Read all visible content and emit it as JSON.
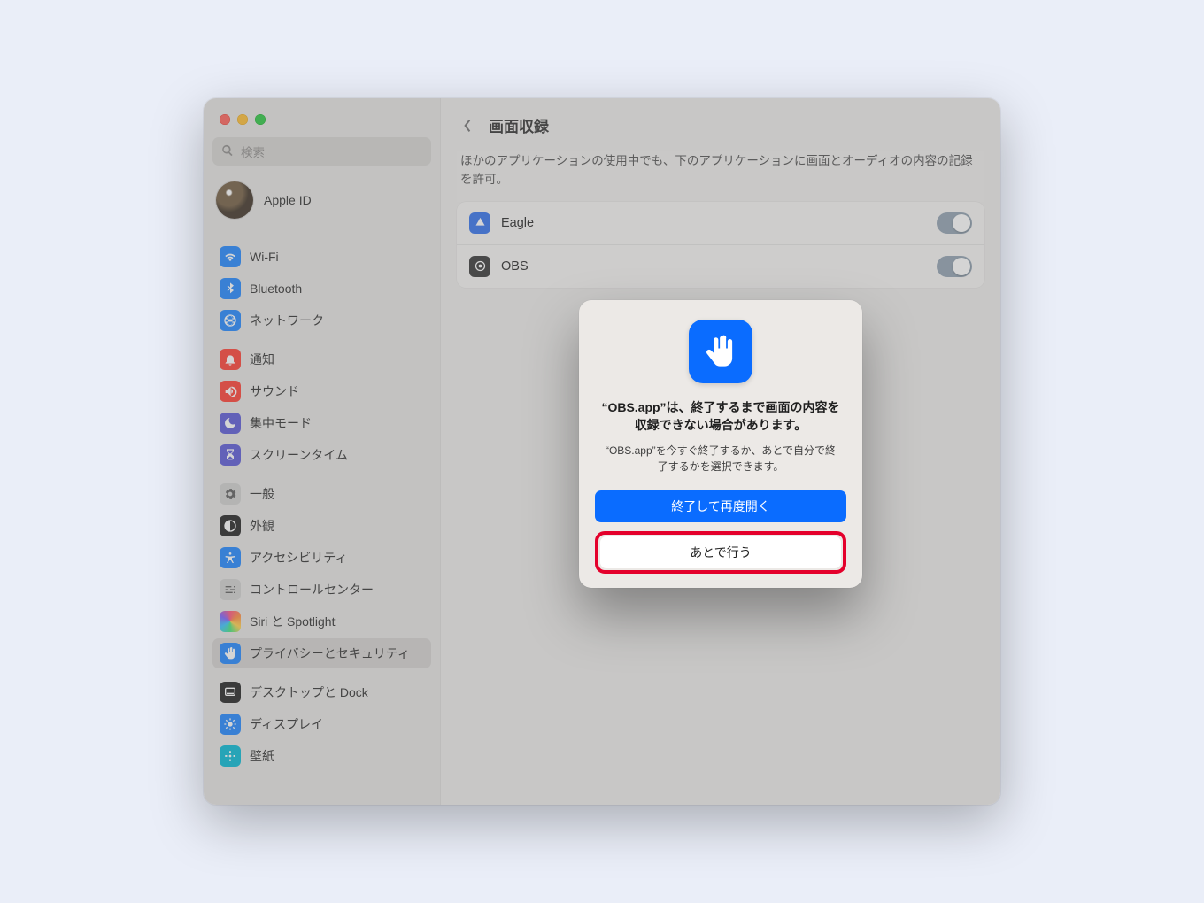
{
  "sidebar": {
    "search_placeholder": "検索",
    "apple_id_label": "Apple ID",
    "groups": [
      {
        "items": [
          {
            "key": "wifi",
            "label": "Wi-Fi",
            "color": "blue"
          },
          {
            "key": "bluetooth",
            "label": "Bluetooth",
            "color": "blue"
          },
          {
            "key": "network",
            "label": "ネットワーク",
            "color": "blue"
          }
        ]
      },
      {
        "items": [
          {
            "key": "notifications",
            "label": "通知",
            "color": "red"
          },
          {
            "key": "sound",
            "label": "サウンド",
            "color": "red"
          },
          {
            "key": "focus",
            "label": "集中モード",
            "color": "indigo"
          },
          {
            "key": "screentime",
            "label": "スクリーンタイム",
            "color": "indigo"
          }
        ]
      },
      {
        "items": [
          {
            "key": "general",
            "label": "一般",
            "color": "gray"
          },
          {
            "key": "appearance",
            "label": "外観",
            "color": "black"
          },
          {
            "key": "accessibility",
            "label": "アクセシビリティ",
            "color": "blue"
          },
          {
            "key": "controlcenter",
            "label": "コントロールセンター",
            "color": "gray"
          },
          {
            "key": "siri",
            "label": "Siri と Spotlight",
            "color": "siri"
          },
          {
            "key": "privacy",
            "label": "プライバシーとセキュリティ",
            "color": "blue",
            "selected": true
          }
        ]
      },
      {
        "items": [
          {
            "key": "desktop",
            "label": "デスクトップと Dock",
            "color": "black"
          },
          {
            "key": "displays",
            "label": "ディスプレイ",
            "color": "blue"
          },
          {
            "key": "wallpaper",
            "label": "壁紙",
            "color": "teal"
          }
        ]
      }
    ]
  },
  "main": {
    "title": "画面収録",
    "description": "ほかのアプリケーションの使用中でも、下のアプリケーションに画面とオーディオの内容の記録を許可。",
    "apps": [
      {
        "key": "eagle",
        "name": "Eagle",
        "on": true
      },
      {
        "key": "obs",
        "name": "OBS",
        "on": true
      }
    ]
  },
  "dialog": {
    "title": "“OBS.app”は、終了するまで画面の内容を収録できない場合があります。",
    "subtitle": "“OBS.app”を今すぐ終了するか、あとで自分で終了するかを選択できます。",
    "primary_label": "終了して再度開く",
    "secondary_label": "あとで行う"
  }
}
